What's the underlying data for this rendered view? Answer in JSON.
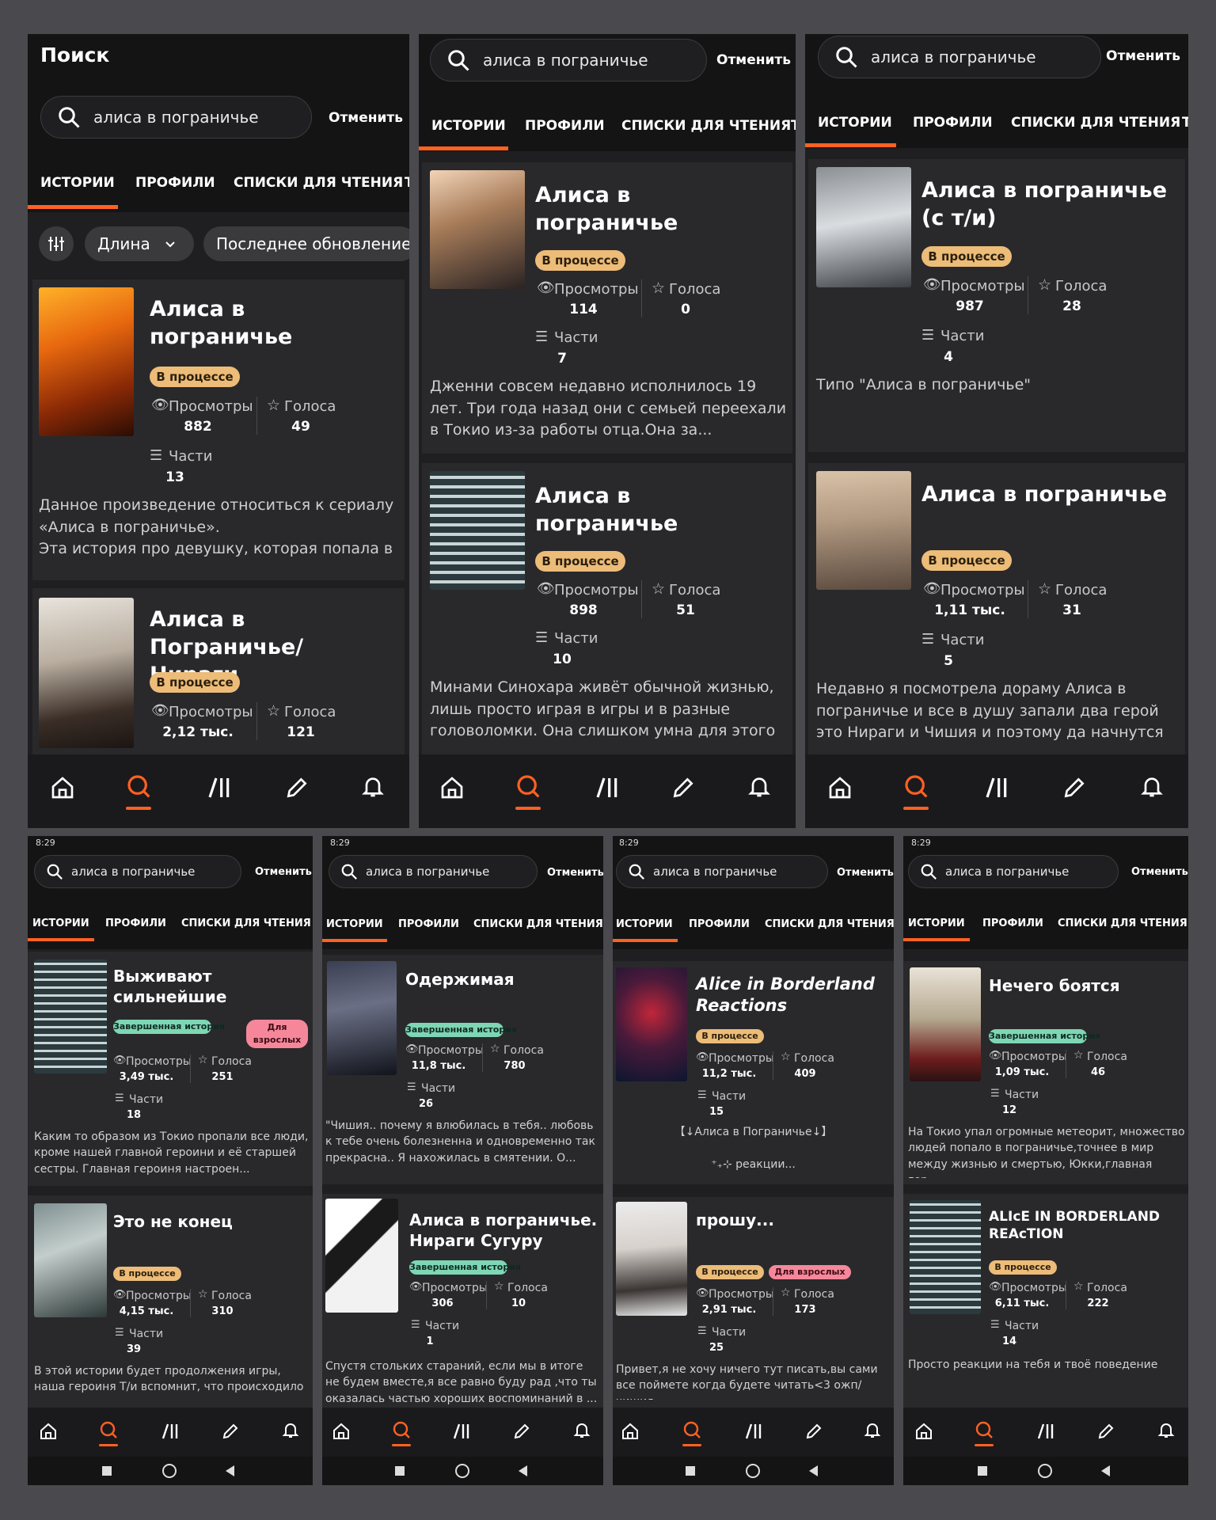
{
  "common": {
    "screen_title": "Поиск",
    "query": "алиса в пограничье",
    "cancel": "Отменить",
    "tabs": [
      "ИСТОРИИ",
      "ПРОФИЛИ",
      "СПИСКИ ДЛЯ ЧТЕНИЯ",
      "Т"
    ],
    "filter_length": "Длина",
    "filter_updated": "Последнее обновление",
    "views_label": "Просмотры",
    "votes_label": "Голоса",
    "parts_label": "Части",
    "status_time": "8:29"
  },
  "screens": [
    {
      "cards": [
        {
          "title": "Алиса в пограничье",
          "status": "В процессе",
          "views": "882",
          "votes": "49",
          "parts": "13",
          "desc": "Данное произведение относиться к сериалу «Алиса в пограничье».\nЭта история про девушку, которая попала в ..."
        },
        {
          "title": "Алиса в Пограничье/ Нираги",
          "status": "В процессе",
          "views": "2,12 тыс.",
          "votes": "121",
          "parts": "",
          "desc": ""
        }
      ]
    },
    {
      "cards": [
        {
          "title": "Алиса в пограничье",
          "status": "В процессе",
          "views": "114",
          "votes": "0",
          "parts": "7",
          "desc": "Дженни совсем недавно исполнилось 19 лет. Три года назад они с семьей переехали в Токио из-за работы отца.Она за..."
        },
        {
          "title": "Алиса в пограничье",
          "status": "В процессе",
          "views": "898",
          "votes": "51",
          "parts": "10",
          "desc": "Минами Синохара живёт обычной жизнью, лишь просто играя в игры и в разные головоломки. Она слишком умна для этого м..."
        }
      ]
    },
    {
      "cards": [
        {
          "title": "Алиса в пограничье (с т/и)",
          "status": "В процессе",
          "views": "987",
          "votes": "28",
          "parts": "4",
          "desc": "Типо \"Алиса в пограничье\""
        },
        {
          "title": "Алиса в пограничье",
          "status": "В процессе",
          "views": "1,11 тыс.",
          "votes": "31",
          "parts": "5",
          "desc": "Недавно я посмотрела дораму Алиса в пограничье и все в душу запали два герой это Нираги и Чишия и поэтому да начнутся л..."
        }
      ]
    },
    {
      "cards": [
        {
          "title": "Выживают сильнейшие",
          "status": "Завершенная история",
          "extra": "Для взрослых",
          "views": "3,49 тыс.",
          "votes": "251",
          "parts": "18",
          "desc": "Каким то образом из Токио пропали все люди, кроме нашей главной героини и её старшей сестры. Главная героиня настроен..."
        },
        {
          "title": "Это не конец",
          "status": "В процессе",
          "views": "4,15 тыс.",
          "votes": "310",
          "parts": "39",
          "desc": "В этой истории будет продолжения игры, наша героиня Т/и вспомнит, что происходило"
        }
      ]
    },
    {
      "cards": [
        {
          "title": "Одержимая",
          "status": "Завершенная история",
          "views": "11,8 тыс.",
          "votes": "780",
          "parts": "26",
          "desc": "\"Чишия.. почему я влюбилась в тебя.. любовь к тебе очень болезненна и одновременно так прекрасна.. Я нахожилась в смятении. О..."
        },
        {
          "title": "Алиса в пограничье. Нираги Сугуру",
          "status": "Завершенная история",
          "views": "306",
          "votes": "10",
          "parts": "1",
          "desc": "Спустя стольких стараний, если мы в итоге не будем вместе,я все равно буду рад ,что ты оказалась частью хороших воспоминаний в ..."
        }
      ]
    },
    {
      "cards": [
        {
          "title": "Alice in Borderland Reactions",
          "status": "В процессе",
          "views": "11,2 тыс.",
          "votes": "409",
          "parts": "15",
          "desc": "【↓Алиса в Пограничье↓】\n\n⁺₊⊹ реакции..."
        },
        {
          "title": "прошу...",
          "status": "В процессе",
          "extra": "Для взрослых",
          "views": "2,91 тыс.",
          "votes": "173",
          "parts": "25",
          "desc": "Привет,я не хочу ничего тут писать,вы сами все поймете когда будете читать<3 ожп/чишия"
        }
      ]
    },
    {
      "cards": [
        {
          "title": "Нечего боятся",
          "status": "Завершенная история",
          "views": "1,09 тыс.",
          "votes": "46",
          "parts": "12",
          "desc": "На Токио упал огромные метеорит, множество людей попало в пограничье,точнее в мир между жизнью и смертью, Юкки,главная гер..."
        },
        {
          "title": "ALIcE IN BORDERLAND REAcTION",
          "status": "В процессе",
          "views": "6,11 тыс.",
          "votes": "222",
          "parts": "14",
          "desc": "Просто реакции на тебя и твоё поведение"
        }
      ]
    }
  ]
}
